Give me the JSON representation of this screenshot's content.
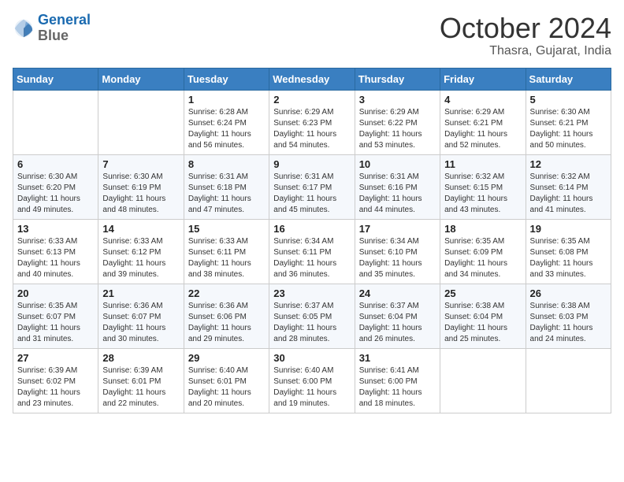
{
  "header": {
    "logo_line1": "General",
    "logo_line2": "Blue",
    "month": "October 2024",
    "location": "Thasra, Gujarat, India"
  },
  "weekdays": [
    "Sunday",
    "Monday",
    "Tuesday",
    "Wednesday",
    "Thursday",
    "Friday",
    "Saturday"
  ],
  "weeks": [
    [
      {
        "day": "",
        "info": ""
      },
      {
        "day": "",
        "info": ""
      },
      {
        "day": "1",
        "info": "Sunrise: 6:28 AM\nSunset: 6:24 PM\nDaylight: 11 hours and 56 minutes."
      },
      {
        "day": "2",
        "info": "Sunrise: 6:29 AM\nSunset: 6:23 PM\nDaylight: 11 hours and 54 minutes."
      },
      {
        "day": "3",
        "info": "Sunrise: 6:29 AM\nSunset: 6:22 PM\nDaylight: 11 hours and 53 minutes."
      },
      {
        "day": "4",
        "info": "Sunrise: 6:29 AM\nSunset: 6:21 PM\nDaylight: 11 hours and 52 minutes."
      },
      {
        "day": "5",
        "info": "Sunrise: 6:30 AM\nSunset: 6:21 PM\nDaylight: 11 hours and 50 minutes."
      }
    ],
    [
      {
        "day": "6",
        "info": "Sunrise: 6:30 AM\nSunset: 6:20 PM\nDaylight: 11 hours and 49 minutes."
      },
      {
        "day": "7",
        "info": "Sunrise: 6:30 AM\nSunset: 6:19 PM\nDaylight: 11 hours and 48 minutes."
      },
      {
        "day": "8",
        "info": "Sunrise: 6:31 AM\nSunset: 6:18 PM\nDaylight: 11 hours and 47 minutes."
      },
      {
        "day": "9",
        "info": "Sunrise: 6:31 AM\nSunset: 6:17 PM\nDaylight: 11 hours and 45 minutes."
      },
      {
        "day": "10",
        "info": "Sunrise: 6:31 AM\nSunset: 6:16 PM\nDaylight: 11 hours and 44 minutes."
      },
      {
        "day": "11",
        "info": "Sunrise: 6:32 AM\nSunset: 6:15 PM\nDaylight: 11 hours and 43 minutes."
      },
      {
        "day": "12",
        "info": "Sunrise: 6:32 AM\nSunset: 6:14 PM\nDaylight: 11 hours and 41 minutes."
      }
    ],
    [
      {
        "day": "13",
        "info": "Sunrise: 6:33 AM\nSunset: 6:13 PM\nDaylight: 11 hours and 40 minutes."
      },
      {
        "day": "14",
        "info": "Sunrise: 6:33 AM\nSunset: 6:12 PM\nDaylight: 11 hours and 39 minutes."
      },
      {
        "day": "15",
        "info": "Sunrise: 6:33 AM\nSunset: 6:11 PM\nDaylight: 11 hours and 38 minutes."
      },
      {
        "day": "16",
        "info": "Sunrise: 6:34 AM\nSunset: 6:11 PM\nDaylight: 11 hours and 36 minutes."
      },
      {
        "day": "17",
        "info": "Sunrise: 6:34 AM\nSunset: 6:10 PM\nDaylight: 11 hours and 35 minutes."
      },
      {
        "day": "18",
        "info": "Sunrise: 6:35 AM\nSunset: 6:09 PM\nDaylight: 11 hours and 34 minutes."
      },
      {
        "day": "19",
        "info": "Sunrise: 6:35 AM\nSunset: 6:08 PM\nDaylight: 11 hours and 33 minutes."
      }
    ],
    [
      {
        "day": "20",
        "info": "Sunrise: 6:35 AM\nSunset: 6:07 PM\nDaylight: 11 hours and 31 minutes."
      },
      {
        "day": "21",
        "info": "Sunrise: 6:36 AM\nSunset: 6:07 PM\nDaylight: 11 hours and 30 minutes."
      },
      {
        "day": "22",
        "info": "Sunrise: 6:36 AM\nSunset: 6:06 PM\nDaylight: 11 hours and 29 minutes."
      },
      {
        "day": "23",
        "info": "Sunrise: 6:37 AM\nSunset: 6:05 PM\nDaylight: 11 hours and 28 minutes."
      },
      {
        "day": "24",
        "info": "Sunrise: 6:37 AM\nSunset: 6:04 PM\nDaylight: 11 hours and 26 minutes."
      },
      {
        "day": "25",
        "info": "Sunrise: 6:38 AM\nSunset: 6:04 PM\nDaylight: 11 hours and 25 minutes."
      },
      {
        "day": "26",
        "info": "Sunrise: 6:38 AM\nSunset: 6:03 PM\nDaylight: 11 hours and 24 minutes."
      }
    ],
    [
      {
        "day": "27",
        "info": "Sunrise: 6:39 AM\nSunset: 6:02 PM\nDaylight: 11 hours and 23 minutes."
      },
      {
        "day": "28",
        "info": "Sunrise: 6:39 AM\nSunset: 6:01 PM\nDaylight: 11 hours and 22 minutes."
      },
      {
        "day": "29",
        "info": "Sunrise: 6:40 AM\nSunset: 6:01 PM\nDaylight: 11 hours and 20 minutes."
      },
      {
        "day": "30",
        "info": "Sunrise: 6:40 AM\nSunset: 6:00 PM\nDaylight: 11 hours and 19 minutes."
      },
      {
        "day": "31",
        "info": "Sunrise: 6:41 AM\nSunset: 6:00 PM\nDaylight: 11 hours and 18 minutes."
      },
      {
        "day": "",
        "info": ""
      },
      {
        "day": "",
        "info": ""
      }
    ]
  ]
}
